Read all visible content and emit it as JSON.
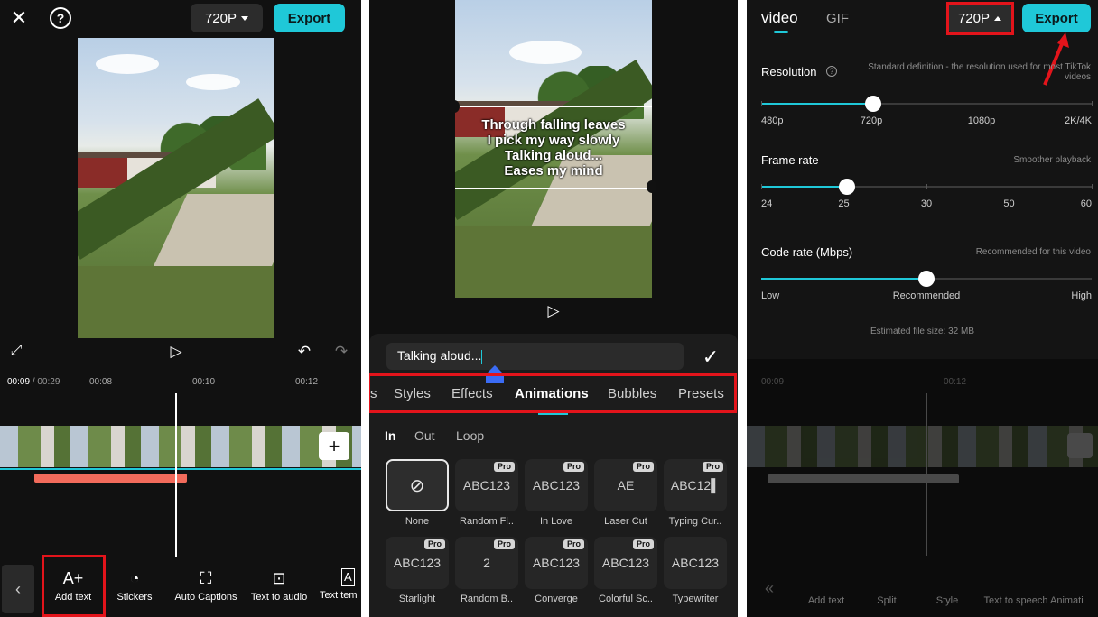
{
  "panel1": {
    "close_icon": "close-icon",
    "help_icon": "help-icon",
    "resolution": "720P",
    "export_label": "Export",
    "current_time": "00:09",
    "total_time": "/ 00:29",
    "time_marks": [
      "00:08",
      "00:10",
      "00:12"
    ],
    "toolbar": [
      {
        "label": "Add text",
        "icon": "A+"
      },
      {
        "label": "Stickers",
        "icon": "◔"
      },
      {
        "label": "Auto Captions",
        "icon": "⛶"
      },
      {
        "label": "Text to audio",
        "icon": "⊡"
      },
      {
        "label": "Text tem",
        "icon": "A"
      }
    ]
  },
  "panel2": {
    "lyrics": [
      "Through falling leaves",
      "I pick my way slowly",
      "Talking aloud...",
      "Eases my mind"
    ],
    "text_input_value": "Talking aloud...",
    "tabs": [
      {
        "label": "s",
        "active": false
      },
      {
        "label": "Styles",
        "active": false
      },
      {
        "label": "Effects",
        "active": false
      },
      {
        "label": "Animations",
        "active": true
      },
      {
        "label": "Bubbles",
        "active": false
      },
      {
        "label": "Presets",
        "active": false
      }
    ],
    "subtabs": [
      {
        "label": "In",
        "active": true
      },
      {
        "label": "Out",
        "active": false
      },
      {
        "label": "Loop",
        "active": false
      }
    ],
    "pro_badge": "Pro",
    "animations": [
      {
        "label": "None",
        "preview": "",
        "pro": false,
        "selected": true
      },
      {
        "label": "Random Fl..",
        "preview": "ABC123",
        "pro": true,
        "selected": false
      },
      {
        "label": "In Love",
        "preview": "ABC123",
        "pro": true,
        "selected": false
      },
      {
        "label": "Laser Cut",
        "preview": "AE",
        "pro": true,
        "selected": false
      },
      {
        "label": "Typing Cur..",
        "preview": "ABC12▌",
        "pro": true,
        "selected": false
      },
      {
        "label": "Starlight",
        "preview": "ABC123",
        "pro": true,
        "selected": false
      },
      {
        "label": "Random B..",
        "preview": "2",
        "pro": true,
        "selected": false
      },
      {
        "label": "Converge",
        "preview": "ABC123",
        "pro": true,
        "selected": false
      },
      {
        "label": "Colorful Sc..",
        "preview": "ABC123",
        "pro": true,
        "selected": false
      },
      {
        "label": "Typewriter",
        "preview": "ABC123",
        "pro": false,
        "selected": false
      }
    ]
  },
  "panel3": {
    "tabs": [
      {
        "label": "video",
        "active": true
      },
      {
        "label": "GIF",
        "active": false
      }
    ],
    "resolution": "720P",
    "export_label": "Export",
    "resolution_section": {
      "title": "Resolution",
      "hint": "Standard definition - the resolution used for most TikTok videos",
      "labels": [
        "480p",
        "720p",
        "1080p",
        "2K/4K"
      ],
      "selected_index": 1
    },
    "frame_rate_section": {
      "title": "Frame rate",
      "hint": "Smoother playback",
      "labels": [
        "24",
        "25",
        "30",
        "50",
        "60"
      ],
      "selected_index": 1
    },
    "code_rate_section": {
      "title": "Code rate (Mbps)",
      "hint": "Recommended for this video",
      "labels": [
        "Low",
        "Recommended",
        "High"
      ],
      "selected_fraction": 0.5
    },
    "file_size": "Estimated file size: 32 MB",
    "dim_time_marks": [
      "00:09",
      "00:12"
    ],
    "dim_toolbar": [
      "Add text",
      "Split",
      "Style",
      "Text to speech",
      "Animati"
    ]
  },
  "colors": {
    "accent": "#1fc8d8",
    "highlight": "#e3141b",
    "clip": "#f26b5b"
  }
}
